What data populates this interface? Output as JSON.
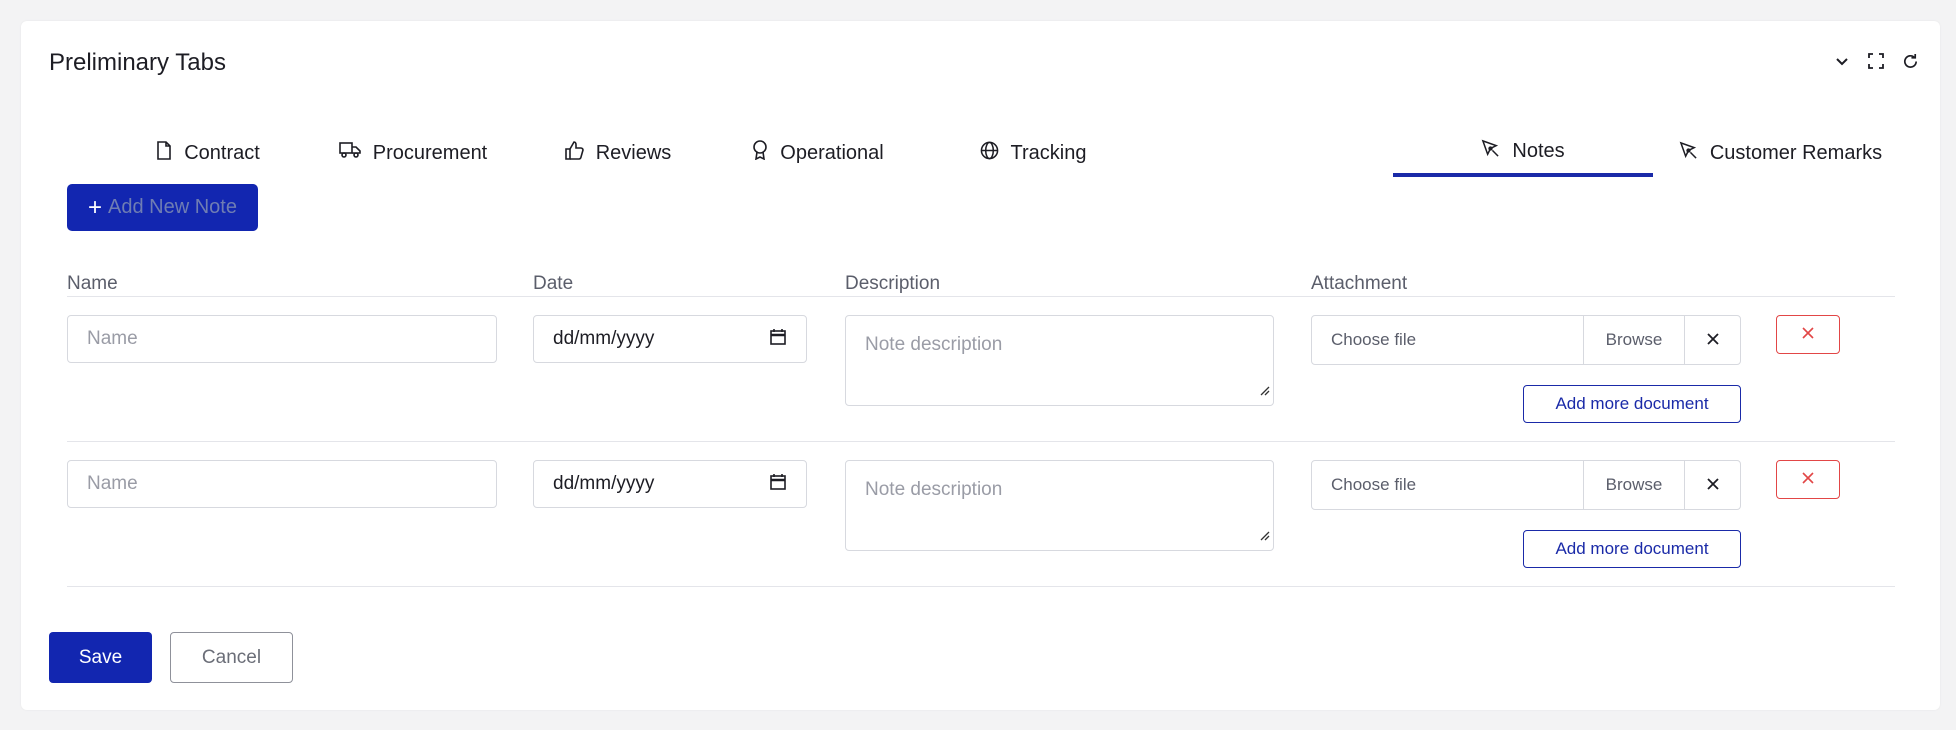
{
  "header": {
    "title": "Preliminary Tabs",
    "icons": [
      "chevron-down-icon",
      "fullscreen-icon",
      "refresh-icon"
    ]
  },
  "tabs": [
    {
      "label": "Contract",
      "icon": "document-icon",
      "active": false
    },
    {
      "label": "Procurement",
      "icon": "truck-icon",
      "active": false
    },
    {
      "label": "Reviews",
      "icon": "thumbs-up-icon",
      "active": false
    },
    {
      "label": "Operational",
      "icon": "award-icon",
      "active": false
    },
    {
      "label": "Tracking",
      "icon": "globe-icon",
      "active": false
    },
    {
      "label": "Notes",
      "icon": "pen-tool-icon",
      "active": true
    },
    {
      "label": "Customer Remarks",
      "icon": "pen-tool-icon",
      "active": false
    }
  ],
  "add_button": {
    "label": "Add New Note",
    "icon": "plus-icon"
  },
  "columns": [
    "Name",
    "Date",
    "Description",
    "Attachment"
  ],
  "rows": [
    {
      "name_placeholder": "Name",
      "date_value": "dd/mm/yyyy",
      "description_placeholder": "Note description",
      "file_placeholder": "Choose file",
      "browse_label": "Browse",
      "add_more_label": "Add more document"
    },
    {
      "name_placeholder": "Name",
      "date_value": "dd/mm/yyyy",
      "description_placeholder": "Note description",
      "file_placeholder": "Choose file",
      "browse_label": "Browse",
      "add_more_label": "Add more document"
    }
  ],
  "footer": {
    "save_label": "Save",
    "cancel_label": "Cancel"
  },
  "colors": {
    "accent": "#1226b0",
    "danger": "#e24646",
    "muted_text": "#5b5e6b"
  }
}
